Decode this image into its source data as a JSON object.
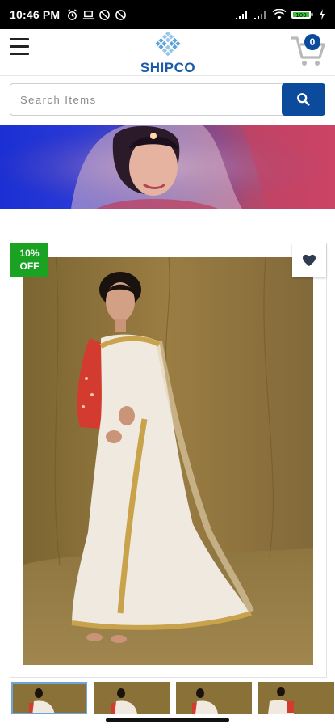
{
  "status_bar": {
    "time": "10:46 PM",
    "battery_level": "100"
  },
  "header": {
    "logo_text": "SHIPCO",
    "cart_count": "0"
  },
  "search": {
    "placeholder": "Search Items"
  },
  "product": {
    "discount_line1": "10%",
    "discount_line2": "OFF",
    "thumbnail_count": 4,
    "active_thumbnail": 1
  },
  "colors": {
    "brand_blue": "#0c4a9c",
    "discount_green": "#1aa223"
  }
}
